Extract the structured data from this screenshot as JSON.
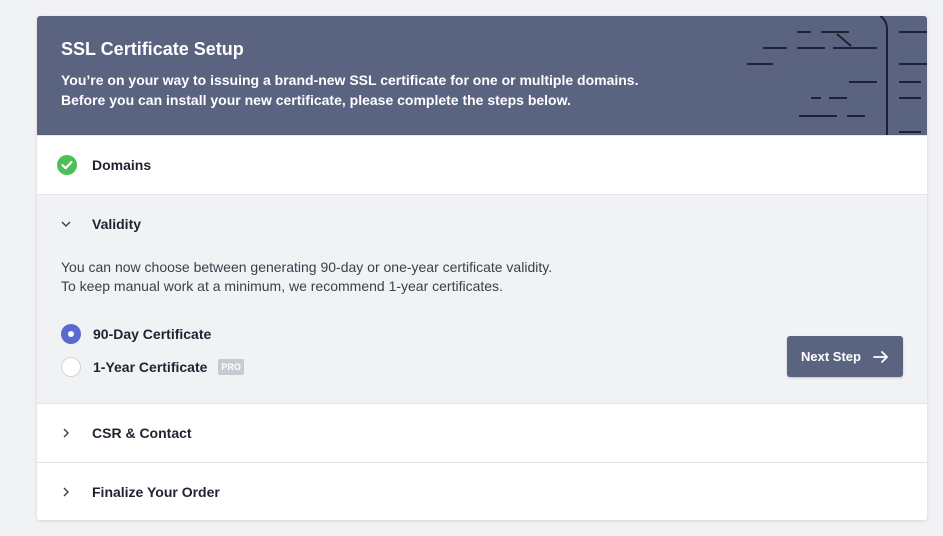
{
  "header": {
    "title": "SSL Certificate Setup",
    "line1": "You’re on your way to issuing a brand-new SSL certificate for one or multiple domains.",
    "line2": "Before you can install your new certificate, please complete the steps below."
  },
  "steps": [
    {
      "title": "Domains",
      "state": "completed",
      "icon": "check-circle-icon"
    },
    {
      "title": "Validity",
      "state": "expanded",
      "icon": "chevron-down-icon",
      "desc1": "You can now choose between generating 90-day or one-year certificate validity.",
      "desc2": "To keep manual work at a minimum, we recommend 1-year certificates.",
      "options": [
        {
          "label": "90-Day Certificate",
          "selected": true
        },
        {
          "label": "1-Year Certificate",
          "selected": false,
          "badge": "PRO"
        }
      ],
      "next_label": "Next Step"
    },
    {
      "title": "CSR & Contact",
      "state": "collapsed",
      "icon": "chevron-right-icon"
    },
    {
      "title": "Finalize Your Order",
      "state": "collapsed",
      "icon": "chevron-right-icon"
    }
  ],
  "colors": {
    "header_bg": "#5a6380",
    "success": "#4cc057",
    "radio_accent": "#5a6bcf",
    "page_bg": "#f1f2f4"
  }
}
